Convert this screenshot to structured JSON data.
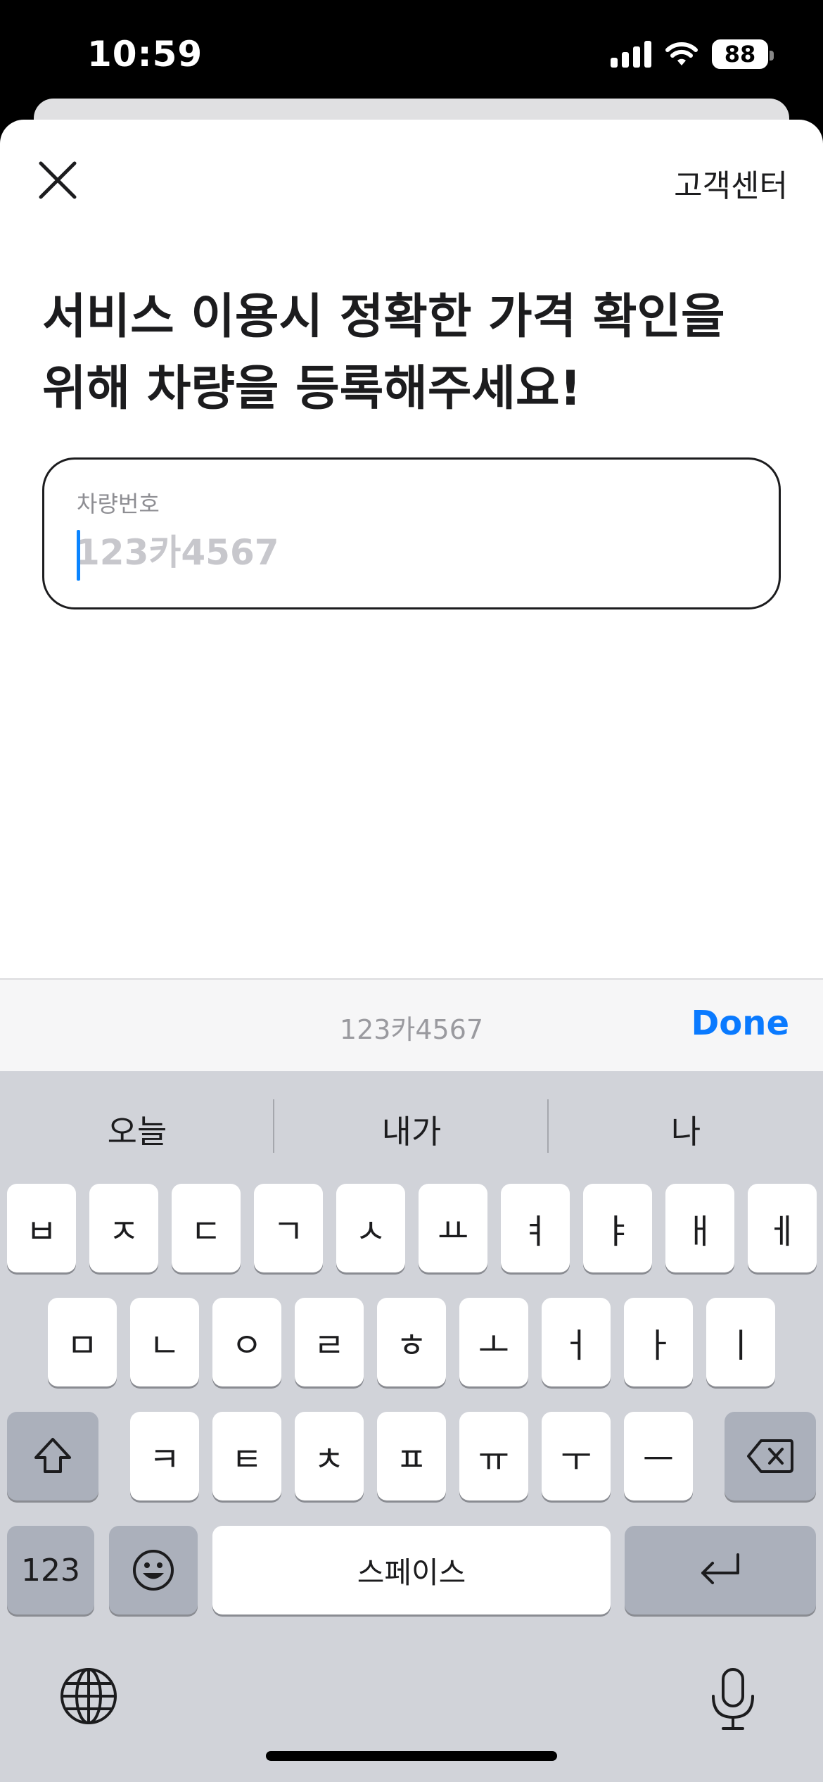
{
  "status_bar": {
    "time": "10:59",
    "battery": "88"
  },
  "header": {
    "support_label": "고객센터"
  },
  "headline": {
    "line1": "서비스 이용시 정확한 가격 확인을",
    "line2": "위해 차량을 등록해주세요!"
  },
  "plate_field": {
    "label": "차량번호",
    "placeholder": "123카4567",
    "value": ""
  },
  "accessory": {
    "preview": "123카4567",
    "done_label": "Done"
  },
  "keyboard": {
    "suggestions": [
      "오늘",
      "내가",
      "나"
    ],
    "row1": [
      "ㅂ",
      "ㅈ",
      "ㄷ",
      "ㄱ",
      "ㅅ",
      "ㅛ",
      "ㅕ",
      "ㅑ",
      "ㅐ",
      "ㅔ"
    ],
    "row2": [
      "ㅁ",
      "ㄴ",
      "ㅇ",
      "ㄹ",
      "ㅎ",
      "ㅗ",
      "ㅓ",
      "ㅏ",
      "ㅣ"
    ],
    "row3": [
      "ㅋ",
      "ㅌ",
      "ㅊ",
      "ㅍ",
      "ㅠ",
      "ㅜ",
      "ㅡ"
    ],
    "numbers_label": "123",
    "space_label": "스페이스",
    "icons": [
      "close-icon",
      "shift-icon",
      "backspace-icon",
      "emoji-icon",
      "return-icon",
      "globe-icon",
      "microphone-icon"
    ]
  }
}
